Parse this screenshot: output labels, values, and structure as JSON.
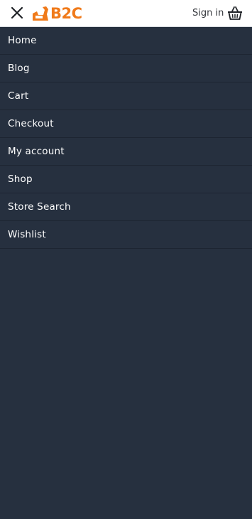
{
  "header": {
    "brand": "B2C",
    "brand_color": "#f07a1a",
    "signin_label": "Sign in",
    "icons": [
      "close-icon",
      "logo-icon",
      "basket-icon"
    ]
  },
  "menu": {
    "background": "#26303f",
    "items": [
      {
        "label": "Home"
      },
      {
        "label": "Blog"
      },
      {
        "label": "Cart"
      },
      {
        "label": "Checkout"
      },
      {
        "label": "My account"
      },
      {
        "label": "Shop"
      },
      {
        "label": "Store Search"
      },
      {
        "label": "Wishlist"
      }
    ]
  }
}
